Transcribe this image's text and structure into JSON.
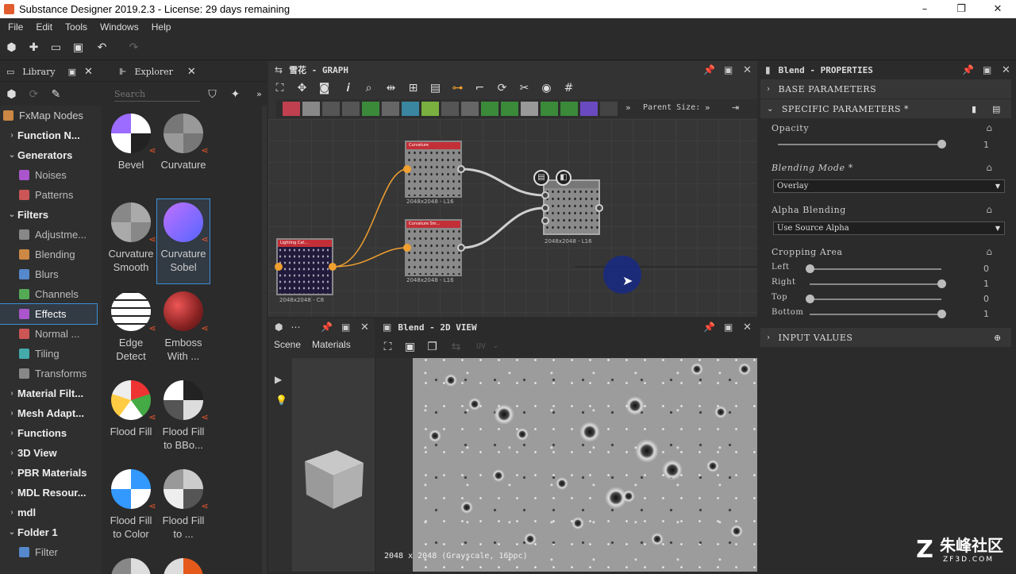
{
  "window": {
    "title": "Substance Designer 2019.2.3 - License: 29 days remaining",
    "controls": [
      "–",
      "❐",
      "✕"
    ]
  },
  "menu": [
    "File",
    "Edit",
    "Tools",
    "Windows",
    "Help"
  ],
  "library": {
    "tabs": [
      "Library",
      "Explorer"
    ],
    "search_placeholder": "Search",
    "categories": [
      {
        "label": "FxMap Nodes",
        "type": "top"
      },
      {
        "label": "Function N...",
        "type": "group"
      },
      {
        "label": "Generators",
        "type": "group-open"
      },
      {
        "label": "Noises",
        "type": "sub"
      },
      {
        "label": "Patterns",
        "type": "sub"
      },
      {
        "label": "Filters",
        "type": "group-open"
      },
      {
        "label": "Adjustme...",
        "type": "sub"
      },
      {
        "label": "Blending",
        "type": "sub"
      },
      {
        "label": "Blurs",
        "type": "sub"
      },
      {
        "label": "Channels",
        "type": "sub"
      },
      {
        "label": "Effects",
        "type": "sub",
        "selected": true
      },
      {
        "label": "Normal ...",
        "type": "sub"
      },
      {
        "label": "Tiling",
        "type": "sub"
      },
      {
        "label": "Transforms",
        "type": "sub"
      },
      {
        "label": "Material Filt...",
        "type": "group"
      },
      {
        "label": "Mesh Adapt...",
        "type": "group"
      },
      {
        "label": "Functions",
        "type": "group"
      },
      {
        "label": "3D View",
        "type": "group"
      },
      {
        "label": "PBR Materials",
        "type": "group"
      },
      {
        "label": "MDL Resour...",
        "type": "group"
      },
      {
        "label": "mdl",
        "type": "group"
      },
      {
        "label": "Folder 1",
        "type": "group-open"
      },
      {
        "label": "Filter",
        "type": "sub"
      }
    ],
    "thumbnails": [
      {
        "l1": "Bevel",
        "l2": ""
      },
      {
        "l1": "Curvature",
        "l2": ""
      },
      {
        "l1": "Curvature",
        "l2": "Smooth"
      },
      {
        "l1": "Curvature",
        "l2": "Sobel",
        "selected": true
      },
      {
        "l1": "Edge",
        "l2": "Detect"
      },
      {
        "l1": "Emboss",
        "l2": "With ..."
      },
      {
        "l1": "Flood Fill",
        "l2": ""
      },
      {
        "l1": "Flood Fill",
        "l2": "to BBo..."
      },
      {
        "l1": "Flood Fill",
        "l2": "to Color"
      },
      {
        "l1": "Flood Fill",
        "l2": "to ..."
      }
    ]
  },
  "graph": {
    "title": "雪花 - GRAPH",
    "parent_size_label": "Parent Size:",
    "nodes": [
      {
        "title": "Curvature",
        "label": "2048x2048 - L16"
      },
      {
        "title": "Curvature Sm...",
        "label": "2048x2048 - L16"
      },
      {
        "title": "Lighting Cat...",
        "label": "2048x2048 - C8"
      },
      {
        "title": "",
        "label": "2048x2048 - L16"
      }
    ]
  },
  "properties": {
    "title": "Blend - PROPERTIES",
    "base_section": "BASE PARAMETERS",
    "specific_section": "SPECIFIC PARAMETERS *",
    "input_section": "INPUT VALUES",
    "opacity": {
      "label": "Opacity",
      "value": "1",
      "fraction": 1
    },
    "blending_mode": {
      "label": "Blending Mode *",
      "value": "Overlay"
    },
    "alpha_blending": {
      "label": "Alpha Blending",
      "value": "Use Source Alpha"
    },
    "cropping": {
      "label": "Cropping Area",
      "rows": [
        {
          "label": "Left",
          "value": "0",
          "fraction": 0
        },
        {
          "label": "Right",
          "value": "1",
          "fraction": 1
        },
        {
          "label": "Top",
          "value": "0",
          "fraction": 0
        },
        {
          "label": "Bottom",
          "value": "1",
          "fraction": 1
        }
      ]
    }
  },
  "scene": {
    "tabs": [
      "Scene",
      "Materials"
    ]
  },
  "view2d": {
    "title": "Blend - 2D VIEW",
    "uv_label": "UV",
    "status": "2048 x 2048 (Grayscale, 16bpc)"
  },
  "watermark": {
    "text": "朱峰社区",
    "sub": "ZF3D.COM"
  },
  "colors": {
    "accent": "#3b8fd6",
    "node_header": "#c32f37",
    "wire_orange": "#f0a030"
  }
}
